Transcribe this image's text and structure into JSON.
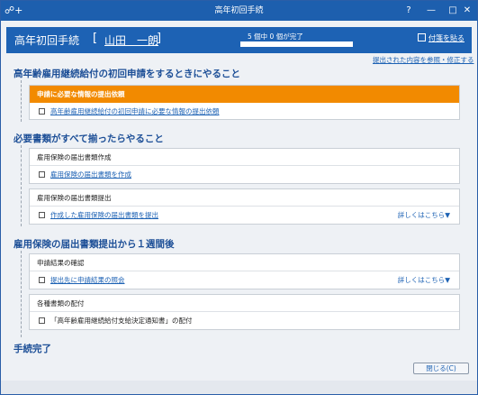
{
  "window": {
    "title": "高年初回手続",
    "app_icon": "☍+",
    "controls": {
      "help": "?",
      "minimize": "—",
      "maximize": "□",
      "close": "✕"
    }
  },
  "header": {
    "procedure_title": "高年初回手続",
    "bracket_open": "[",
    "bracket_close": "]",
    "user_name": "山田　一朗",
    "progress_text": "5 個中 0 個が完了",
    "progress_fraction": 0.0,
    "sticky_button": "付箋を貼る",
    "accent": "#1d62b4",
    "progress_color": "#8fbf3f"
  },
  "reference_link": "提出された内容を参照・修正する",
  "sections": [
    {
      "heading": "高年齢雇用継続給付の初回申請をするときにやること",
      "cards": [
        {
          "title": "申請に必要な情報の提出依頼",
          "highlight_color": "#f28a00",
          "tasks": [
            {
              "label": "高年齢雇用継続給付の初回申請に必要な情報の提出依頼",
              "more": ""
            }
          ]
        }
      ]
    },
    {
      "heading": "必要書類がすべて揃ったらやること",
      "cards": [
        {
          "title": "雇用保険の届出書類作成",
          "tasks": [
            {
              "label": "雇用保険の届出書類を作成",
              "more": ""
            }
          ]
        },
        {
          "title": "雇用保険の届出書類提出",
          "tasks": [
            {
              "label": "作成した雇用保険の届出書類を提出",
              "more": "詳しくはこちら▼"
            }
          ]
        }
      ]
    },
    {
      "heading": "雇用保険の届出書類提出から１週間後",
      "cards": [
        {
          "title": "申請結果の確認",
          "tasks": [
            {
              "label": "提出先に申請結果の照会",
              "more": "詳しくはこちら▼"
            }
          ]
        },
        {
          "title": "各種書類の配付",
          "tasks": [
            {
              "label": "「高年齢雇用継続給付支給決定通知書」の配付",
              "more": ""
            }
          ]
        }
      ]
    }
  ],
  "completion_heading": "手続完了",
  "close_button": "閉じる(C)"
}
